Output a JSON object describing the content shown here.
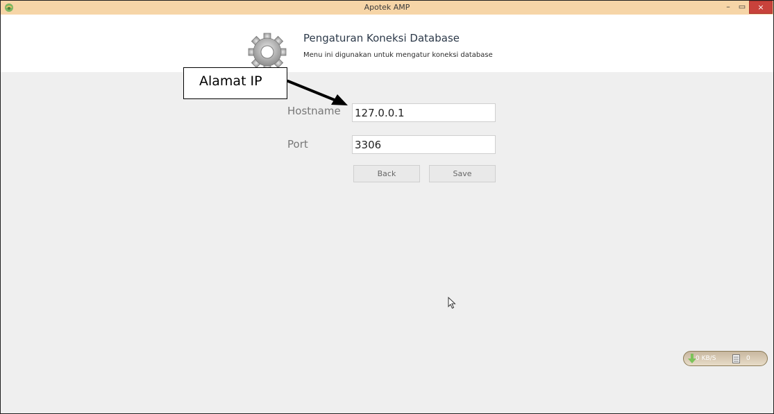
{
  "window": {
    "title": "Apotek AMP",
    "controls": {
      "minimize": "–",
      "maximize": "▭",
      "close": "×"
    }
  },
  "header": {
    "title": "Pengaturan Koneksi Database",
    "description": "Menu ini digunakan untuk mengatur koneksi database",
    "icon": "gear-icon"
  },
  "annotation": {
    "label": "Alamat IP"
  },
  "form": {
    "hostname_label": "Hostname",
    "hostname_value": "127.0.0.1",
    "port_label": "Port",
    "port_value": "3306",
    "back_label": "Back",
    "save_label": "Save"
  },
  "tray_widget": {
    "rate": "0 KB/S",
    "count": "0"
  },
  "colors": {
    "titlebar": "#f6d5a7",
    "close": "#c8423b",
    "background": "#efefef",
    "header": "#ffffff"
  }
}
